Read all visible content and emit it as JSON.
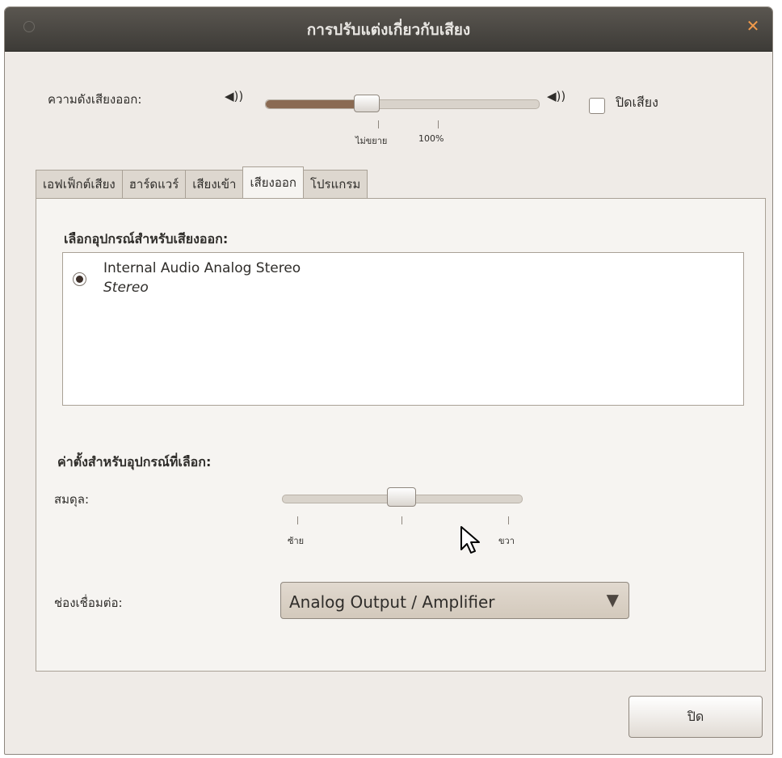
{
  "window": {
    "title": "การปรับแต่งเกี่ยวกับเสียง",
    "close_glyph": "✕"
  },
  "volume": {
    "label": "ความดังเสียงออก:",
    "icon_low": "◀))",
    "icon_high": "◀))",
    "level": 0.38,
    "tick_unamplified": "ไม่ขยาย",
    "tick_100": "100%",
    "mute_label": "ปิดเสียง",
    "mute_checked": false
  },
  "tabs": [
    {
      "label": "เอฟเฟ็กต์เสียง",
      "active": false
    },
    {
      "label": "ฮาร์ดแวร์",
      "active": false
    },
    {
      "label": "เสียงเข้า",
      "active": false
    },
    {
      "label": "เสียงออก",
      "active": true
    },
    {
      "label": "โปรแกรม",
      "active": false
    }
  ],
  "output": {
    "choose_device_label": "เลือกอุปกรณ์สำหรับเสียงออก:",
    "devices": [
      {
        "name": "Internal Audio Analog Stereo",
        "subtitle": "Stereo",
        "selected": true
      }
    ],
    "settings_label": "ค่าตั้งสำหรับอุปกรณ์ที่เลือก:",
    "balance_label": "สมดุล:",
    "balance_value": 0.5,
    "balance_left": "ซ้าย",
    "balance_right": "ขวา",
    "connector_label": "ช่องเชื่อมต่อ:",
    "connector_value": "Analog Output / Amplifier",
    "dropdown_arrow": "▼"
  },
  "footer": {
    "close_label": "ปิด"
  },
  "colors": {
    "titlebar": "#3d3b37",
    "slider_fill": "#8a6a52",
    "close_accent": "#f19a4b"
  }
}
